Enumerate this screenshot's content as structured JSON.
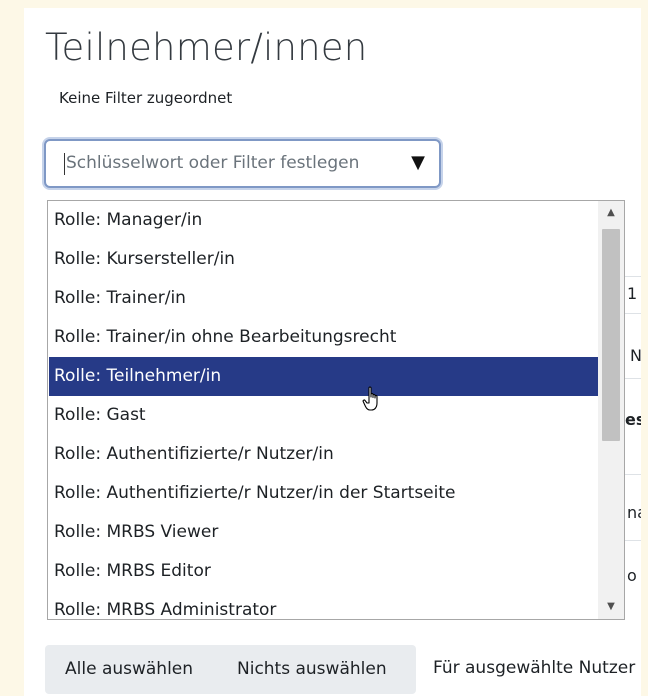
{
  "page": {
    "title": "Teilnehmer/innen",
    "filter_note": "Keine Filter zugeordnet"
  },
  "filter": {
    "placeholder": "Schlüsselwort oder Filter festlegen",
    "arrow_glyph": "▼"
  },
  "dropdown": {
    "options": [
      "Rolle: Manager/in",
      "Rolle: Kursersteller/in",
      "Rolle: Trainer/in",
      "Rolle: Trainer/in ohne Bearbeitungsrecht",
      "Rolle: Teilnehmer/in",
      "Rolle: Gast",
      "Rolle: Authentifizierte/r Nutzer/in",
      "Rolle: Authentifizierte/r Nutzer/in der Startseite",
      "Rolle: MRBS Viewer",
      "Rolle: MRBS Editor",
      "Rolle: MRBS Administrator"
    ],
    "selected_index": 4,
    "scroll_up_glyph": "▲",
    "scroll_down_glyph": "▼"
  },
  "background_table": {
    "fragments": [
      "1",
      "N",
      "es",
      "na",
      "o"
    ]
  },
  "actions": {
    "select_all": "Alle auswählen",
    "select_none": "Nichts auswählen",
    "bulk_label": "Für ausgewählte Nutzer"
  },
  "colors": {
    "selected_bg": "#263a87",
    "focus_border": "#7f98c5",
    "page_bg": "#fdf8e7"
  }
}
